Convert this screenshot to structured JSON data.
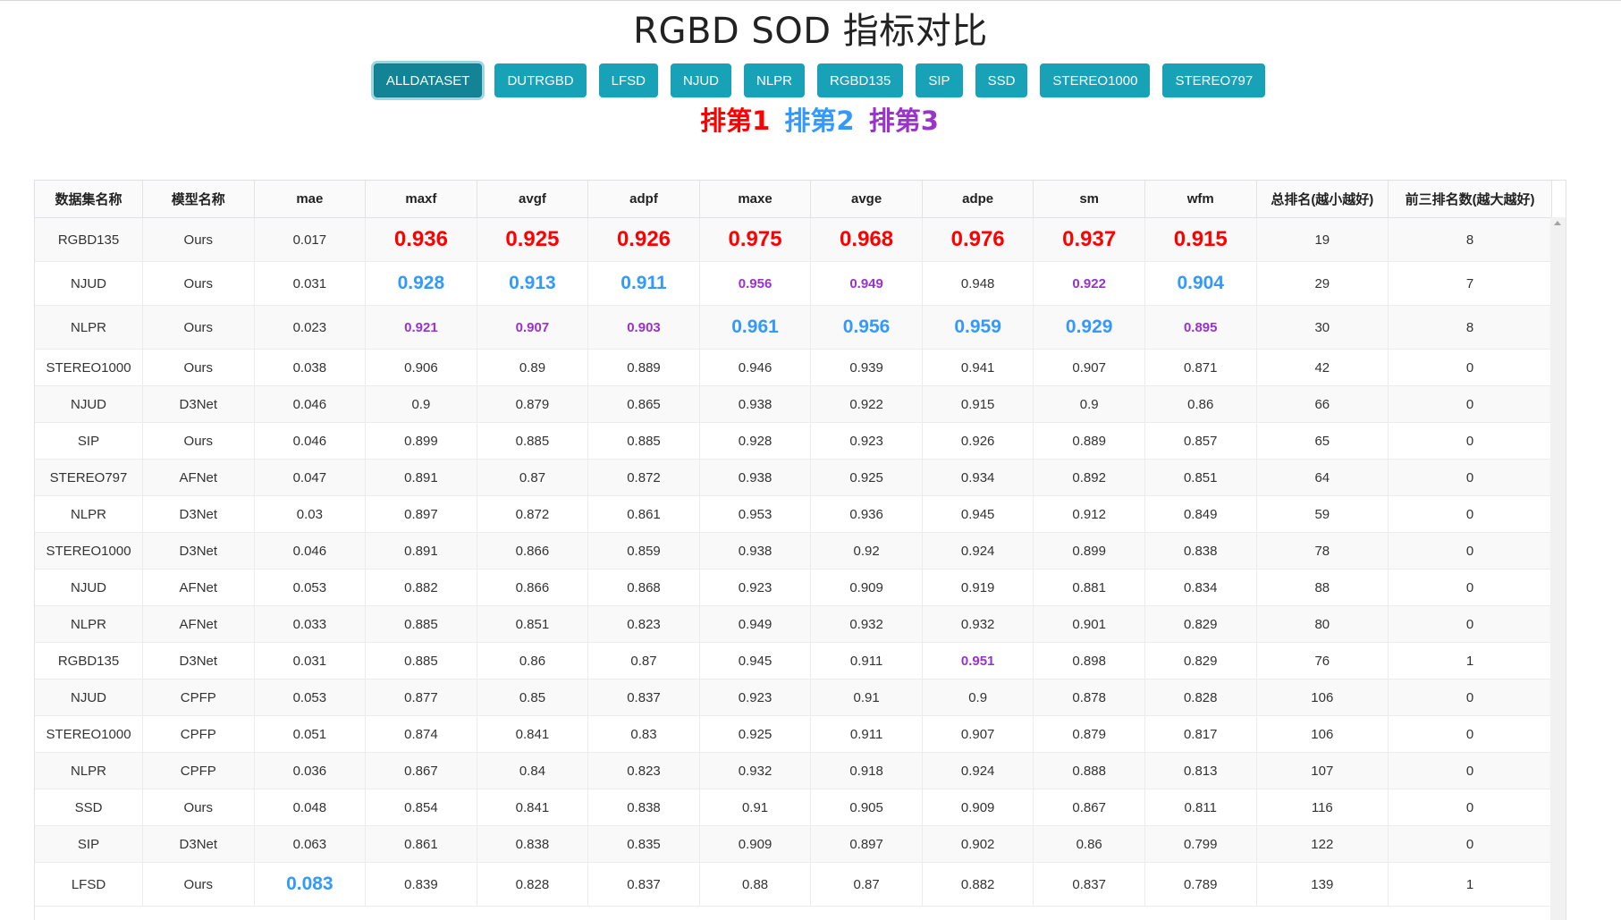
{
  "page": {
    "title": "RGBD SOD 指标对比"
  },
  "datasets": [
    {
      "label": "ALLDATASET",
      "active": true
    },
    {
      "label": "DUTRGBD",
      "active": false
    },
    {
      "label": "LFSD",
      "active": false
    },
    {
      "label": "NJUD",
      "active": false
    },
    {
      "label": "NLPR",
      "active": false
    },
    {
      "label": "RGBD135",
      "active": false
    },
    {
      "label": "SIP",
      "active": false
    },
    {
      "label": "SSD",
      "active": false
    },
    {
      "label": "STEREO1000",
      "active": false
    },
    {
      "label": "STEREO797",
      "active": false
    }
  ],
  "legend": {
    "rank1": "排第1",
    "rank2": "排第2",
    "rank3": "排第3",
    "colors": {
      "rank1": "#ff0000",
      "rank2": "#3399ff",
      "rank3": "#9933cc"
    }
  },
  "table": {
    "headers": [
      "数据集名称",
      "模型名称",
      "mae",
      "maxf",
      "avgf",
      "adpf",
      "maxe",
      "avge",
      "adpe",
      "sm",
      "wfm",
      "总排名(越小越好)",
      "前三排名数(越大越好)"
    ],
    "rows": [
      {
        "cells": [
          "RGBD135",
          "Ours",
          "0.017",
          "0.936",
          "0.925",
          "0.926",
          "0.975",
          "0.968",
          "0.976",
          "0.937",
          "0.915",
          "19",
          "8"
        ],
        "ranks": [
          0,
          0,
          0,
          1,
          1,
          1,
          1,
          1,
          1,
          1,
          1,
          0,
          0
        ]
      },
      {
        "cells": [
          "NJUD",
          "Ours",
          "0.031",
          "0.928",
          "0.913",
          "0.911",
          "0.956",
          "0.949",
          "0.948",
          "0.922",
          "0.904",
          "29",
          "7"
        ],
        "ranks": [
          0,
          0,
          0,
          2,
          2,
          2,
          3,
          3,
          0,
          3,
          2,
          0,
          0
        ]
      },
      {
        "cells": [
          "NLPR",
          "Ours",
          "0.023",
          "0.921",
          "0.907",
          "0.903",
          "0.961",
          "0.956",
          "0.959",
          "0.929",
          "0.895",
          "30",
          "8"
        ],
        "ranks": [
          0,
          0,
          0,
          3,
          3,
          3,
          2,
          2,
          2,
          2,
          3,
          0,
          0
        ]
      },
      {
        "cells": [
          "STEREO1000",
          "Ours",
          "0.038",
          "0.906",
          "0.89",
          "0.889",
          "0.946",
          "0.939",
          "0.941",
          "0.907",
          "0.871",
          "42",
          "0"
        ],
        "ranks": [
          0,
          0,
          0,
          0,
          0,
          0,
          0,
          0,
          0,
          0,
          0,
          0,
          0
        ]
      },
      {
        "cells": [
          "NJUD",
          "D3Net",
          "0.046",
          "0.9",
          "0.879",
          "0.865",
          "0.938",
          "0.922",
          "0.915",
          "0.9",
          "0.86",
          "66",
          "0"
        ],
        "ranks": [
          0,
          0,
          0,
          0,
          0,
          0,
          0,
          0,
          0,
          0,
          0,
          0,
          0
        ]
      },
      {
        "cells": [
          "SIP",
          "Ours",
          "0.046",
          "0.899",
          "0.885",
          "0.885",
          "0.928",
          "0.923",
          "0.926",
          "0.889",
          "0.857",
          "65",
          "0"
        ],
        "ranks": [
          0,
          0,
          0,
          0,
          0,
          0,
          0,
          0,
          0,
          0,
          0,
          0,
          0
        ]
      },
      {
        "cells": [
          "STEREO797",
          "AFNet",
          "0.047",
          "0.891",
          "0.87",
          "0.872",
          "0.938",
          "0.925",
          "0.934",
          "0.892",
          "0.851",
          "64",
          "0"
        ],
        "ranks": [
          0,
          0,
          0,
          0,
          0,
          0,
          0,
          0,
          0,
          0,
          0,
          0,
          0
        ]
      },
      {
        "cells": [
          "NLPR",
          "D3Net",
          "0.03",
          "0.897",
          "0.872",
          "0.861",
          "0.953",
          "0.936",
          "0.945",
          "0.912",
          "0.849",
          "59",
          "0"
        ],
        "ranks": [
          0,
          0,
          0,
          0,
          0,
          0,
          0,
          0,
          0,
          0,
          0,
          0,
          0
        ]
      },
      {
        "cells": [
          "STEREO1000",
          "D3Net",
          "0.046",
          "0.891",
          "0.866",
          "0.859",
          "0.938",
          "0.92",
          "0.924",
          "0.899",
          "0.838",
          "78",
          "0"
        ],
        "ranks": [
          0,
          0,
          0,
          0,
          0,
          0,
          0,
          0,
          0,
          0,
          0,
          0,
          0
        ]
      },
      {
        "cells": [
          "NJUD",
          "AFNet",
          "0.053",
          "0.882",
          "0.866",
          "0.868",
          "0.923",
          "0.909",
          "0.919",
          "0.881",
          "0.834",
          "88",
          "0"
        ],
        "ranks": [
          0,
          0,
          0,
          0,
          0,
          0,
          0,
          0,
          0,
          0,
          0,
          0,
          0
        ]
      },
      {
        "cells": [
          "NLPR",
          "AFNet",
          "0.033",
          "0.885",
          "0.851",
          "0.823",
          "0.949",
          "0.932",
          "0.932",
          "0.901",
          "0.829",
          "80",
          "0"
        ],
        "ranks": [
          0,
          0,
          0,
          0,
          0,
          0,
          0,
          0,
          0,
          0,
          0,
          0,
          0
        ]
      },
      {
        "cells": [
          "RGBD135",
          "D3Net",
          "0.031",
          "0.885",
          "0.86",
          "0.87",
          "0.945",
          "0.911",
          "0.951",
          "0.898",
          "0.829",
          "76",
          "1"
        ],
        "ranks": [
          0,
          0,
          0,
          0,
          0,
          0,
          0,
          0,
          3,
          0,
          0,
          0,
          0
        ]
      },
      {
        "cells": [
          "NJUD",
          "CPFP",
          "0.053",
          "0.877",
          "0.85",
          "0.837",
          "0.923",
          "0.91",
          "0.9",
          "0.878",
          "0.828",
          "106",
          "0"
        ],
        "ranks": [
          0,
          0,
          0,
          0,
          0,
          0,
          0,
          0,
          0,
          0,
          0,
          0,
          0
        ]
      },
      {
        "cells": [
          "STEREO1000",
          "CPFP",
          "0.051",
          "0.874",
          "0.841",
          "0.83",
          "0.925",
          "0.911",
          "0.907",
          "0.879",
          "0.817",
          "106",
          "0"
        ],
        "ranks": [
          0,
          0,
          0,
          0,
          0,
          0,
          0,
          0,
          0,
          0,
          0,
          0,
          0
        ]
      },
      {
        "cells": [
          "NLPR",
          "CPFP",
          "0.036",
          "0.867",
          "0.84",
          "0.823",
          "0.932",
          "0.918",
          "0.924",
          "0.888",
          "0.813",
          "107",
          "0"
        ],
        "ranks": [
          0,
          0,
          0,
          0,
          0,
          0,
          0,
          0,
          0,
          0,
          0,
          0,
          0
        ]
      },
      {
        "cells": [
          "SSD",
          "Ours",
          "0.048",
          "0.854",
          "0.841",
          "0.838",
          "0.91",
          "0.905",
          "0.909",
          "0.867",
          "0.811",
          "116",
          "0"
        ],
        "ranks": [
          0,
          0,
          0,
          0,
          0,
          0,
          0,
          0,
          0,
          0,
          0,
          0,
          0
        ]
      },
      {
        "cells": [
          "SIP",
          "D3Net",
          "0.063",
          "0.861",
          "0.838",
          "0.835",
          "0.909",
          "0.897",
          "0.902",
          "0.86",
          "0.799",
          "122",
          "0"
        ],
        "ranks": [
          0,
          0,
          0,
          0,
          0,
          0,
          0,
          0,
          0,
          0,
          0,
          0,
          0
        ]
      },
      {
        "cells": [
          "LFSD",
          "Ours",
          "0.083",
          "0.839",
          "0.828",
          "0.837",
          "0.88",
          "0.87",
          "0.882",
          "0.837",
          "0.789",
          "139",
          "1"
        ],
        "ranks": [
          0,
          0,
          2,
          0,
          0,
          0,
          0,
          0,
          0,
          0,
          0,
          0,
          0
        ]
      }
    ]
  }
}
